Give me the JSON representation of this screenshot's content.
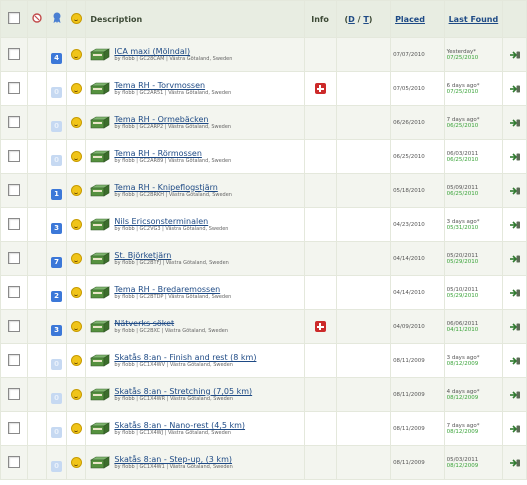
{
  "header": {
    "description": "Description",
    "info": "Info",
    "d_link": "D",
    "slash": " / ",
    "t_link": "T",
    "placed": "Placed",
    "last_found": "Last Found"
  },
  "rows": [
    {
      "favs": "4",
      "title": "ICA maxi (Mölndal)",
      "sub": "by flobb | GC28CAM | Västra Götaland, Sweden",
      "placed": "07/07/2010",
      "lf_text": "Yesterday*",
      "lf_date": "07/25/2010",
      "info": false,
      "struck": false
    },
    {
      "favs": "0",
      "title": "Tema RH - Torvmossen",
      "sub": "by flobb | GC2AR51 | Västra Götaland, Sweden",
      "placed": "07/05/2010",
      "lf_text": "6 days ago*",
      "lf_date": "07/25/2010",
      "info": true,
      "struck": false
    },
    {
      "favs": "0",
      "title": "Tema RH - Ormebäcken",
      "sub": "by flobb | GC2ARP2 | Västra Götaland, Sweden",
      "placed": "06/26/2010",
      "lf_text": "7 days ago*",
      "lf_date": "06/25/2010",
      "info": false,
      "struck": false
    },
    {
      "favs": "0",
      "title": "Tema RH - Rörmossen",
      "sub": "by flobb | GC2AR89 | Västra Götaland, Sweden",
      "placed": "06/25/2010",
      "lf_text": "06/03/2011",
      "lf_date": "06/25/2010",
      "info": false,
      "struck": false
    },
    {
      "favs": "1",
      "title": "Tema RH - Knipeflogstjärn",
      "sub": "by flobb | GC2BRKH | Västra Götaland, Sweden",
      "placed": "05/18/2010",
      "lf_text": "05/09/2011",
      "lf_date": "06/25/2010",
      "info": false,
      "struck": false
    },
    {
      "favs": "3",
      "title": "Nils Ericsonsterminalen",
      "sub": "by flobb | GC2VG3 | Västra Götaland, Sweden",
      "placed": "04/23/2010",
      "lf_text": "3 days ago*",
      "lf_date": "05/31/2010",
      "info": false,
      "struck": false
    },
    {
      "favs": "7",
      "title": "St. Björketjärn",
      "sub": "by flobb | GC2BTFJ | Västra Götaland, Sweden",
      "placed": "04/14/2010",
      "lf_text": "05/20/2011",
      "lf_date": "05/29/2010",
      "info": false,
      "struck": false
    },
    {
      "favs": "2",
      "title": "Tema RH - Bredaremossen",
      "sub": "by flobb | GC2BTDP | Västra Götaland, Sweden",
      "placed": "04/14/2010",
      "lf_text": "05/10/2011",
      "lf_date": "05/29/2010",
      "info": false,
      "struck": false
    },
    {
      "favs": "3",
      "title": "Nätverks söket",
      "sub": "by flobb | GC2BXC | Västra Götaland, Sweden",
      "placed": "04/09/2010",
      "lf_text": "06/06/2011",
      "lf_date": "04/11/2010",
      "info": true,
      "struck": true
    },
    {
      "favs": "0",
      "title": "Skatås 8:an - Finish and rest (8 km)",
      "sub": "by flobb | GC1X4WV | Västra Götaland, Sweden",
      "placed": "08/11/2009",
      "lf_text": "3 days ago*",
      "lf_date": "08/12/2009",
      "info": false,
      "struck": false
    },
    {
      "favs": "0",
      "title": "Skatås 8:an - Stretching (7,05 km)",
      "sub": "by flobb | GC1X4WR | Västra Götaland, Sweden",
      "placed": "08/11/2009",
      "lf_text": "4 days ago*",
      "lf_date": "08/12/2009",
      "info": false,
      "struck": false
    },
    {
      "favs": "0",
      "title": "Skatås 8:an - Nano-rest (4,5 km)",
      "sub": "by flobb | GC1X4WJ | Västra Götaland, Sweden",
      "placed": "08/11/2009",
      "lf_text": "7 days ago*",
      "lf_date": "08/12/2009",
      "info": false,
      "struck": false
    },
    {
      "favs": "0",
      "title": "Skatås 8:an - Step-up, (3 km)",
      "sub": "by flobb | GC1X4W1 | Västra Götaland, Sweden",
      "placed": "08/11/2009",
      "lf_text": "05/03/2011",
      "lf_date": "08/12/2009",
      "info": false,
      "struck": false
    }
  ],
  "icons": {
    "checkbox": "checkbox",
    "favorites": "favorite-badge",
    "smile": "smiley-icon",
    "cache": "traditional-cache-icon",
    "info": "needs-maintenance-icon",
    "arrow": "send-to-gps-icon"
  }
}
